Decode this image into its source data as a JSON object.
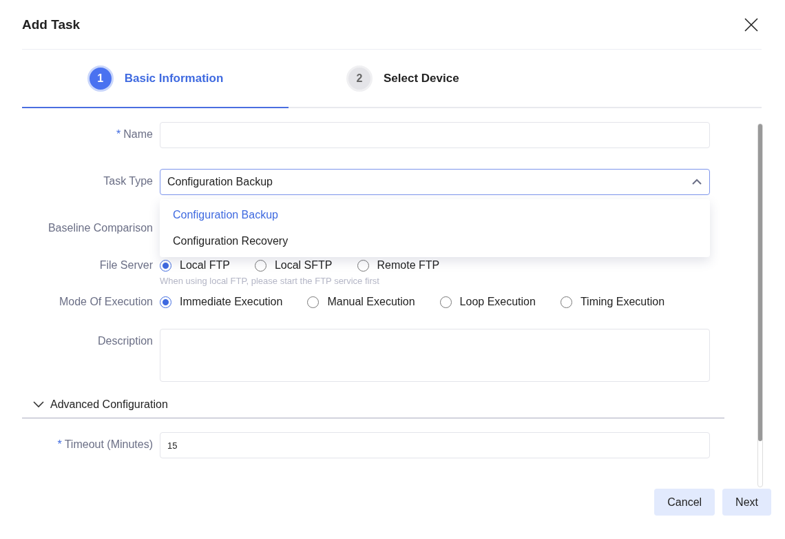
{
  "dialog": {
    "title": "Add Task"
  },
  "steps": [
    {
      "number": "1",
      "label": "Basic Information",
      "selected": true
    },
    {
      "number": "2",
      "label": "Select Device",
      "selected": false
    }
  ],
  "form": {
    "name": {
      "label": "Name",
      "required_mark": "*"
    },
    "task_type": {
      "label": "Task Type",
      "value": "Configuration Backup",
      "expanded": true,
      "options": [
        {
          "label": "Configuration Backup",
          "selected": true
        },
        {
          "label": "Configuration Recovery",
          "selected": false
        }
      ]
    },
    "baseline": {
      "label": "Baseline Comparison"
    },
    "file_server": {
      "label": "File Server",
      "options": [
        {
          "label": "Local FTP",
          "selected": true
        },
        {
          "label": "Local SFTP",
          "selected": false
        },
        {
          "label": "Remote FTP",
          "selected": false
        }
      ],
      "hint": "When using local FTP, please start the FTP service first"
    },
    "mode": {
      "label": "Mode Of Execution",
      "options": [
        {
          "label": "Immediate Execution",
          "selected": true
        },
        {
          "label": "Manual Execution",
          "selected": false
        },
        {
          "label": "Loop Execution",
          "selected": false
        },
        {
          "label": "Timing Execution",
          "selected": false
        }
      ]
    },
    "description": {
      "label": "Description"
    },
    "advanced": {
      "label": "Advanced Configuration",
      "expanded": true
    },
    "timeout": {
      "label": "Timeout (Minutes)",
      "required_mark": "*",
      "value": "15"
    }
  },
  "buttons": [
    {
      "label": "Cancel"
    },
    {
      "label": "Next"
    }
  ]
}
